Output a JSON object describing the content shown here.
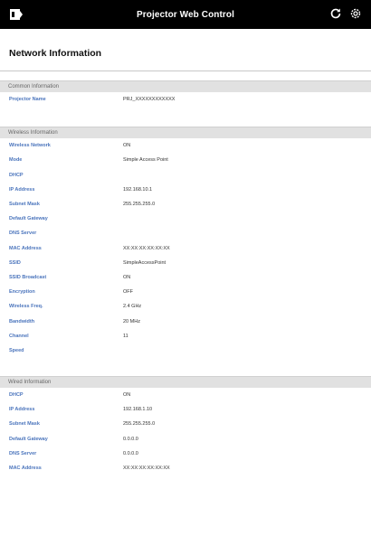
{
  "header": {
    "title": "Projector Web Control"
  },
  "page_title": "Network Information",
  "sections": {
    "common": {
      "title": "Common Information",
      "rows": [
        {
          "label": "Projector Name",
          "value": "PRJ_XXXXXXXXXXXX"
        }
      ]
    },
    "wireless": {
      "title": "Wireless Information",
      "rows": [
        {
          "label": "Wireless Network",
          "value": "ON"
        },
        {
          "label": "Mode",
          "value": "Simple Access Point"
        },
        {
          "label": "DHCP",
          "value": ""
        },
        {
          "label": "IP Address",
          "value": "192.168.10.1"
        },
        {
          "label": "Subnet Mask",
          "value": "255.255.255.0"
        },
        {
          "label": "Default Gateway",
          "value": ""
        },
        {
          "label": "DNS Server",
          "value": ""
        },
        {
          "label": "MAC Address",
          "value": "XX:XX:XX:XX:XX:XX"
        },
        {
          "label": "SSID",
          "value": "SimpleAccessPoint"
        },
        {
          "label": "SSID Broadcast",
          "value": "ON"
        },
        {
          "label": "Encryption",
          "value": "OFF"
        },
        {
          "label": "Wireless Freq.",
          "value": "2.4 GHz"
        },
        {
          "label": "Bandwidth",
          "value": "20 MHz"
        },
        {
          "label": "Channel",
          "value": "11"
        },
        {
          "label": "Speed",
          "value": ""
        }
      ]
    },
    "wired": {
      "title": "Wired Information",
      "rows": [
        {
          "label": "DHCP",
          "value": "ON"
        },
        {
          "label": "IP Address",
          "value": "192.168.1.10"
        },
        {
          "label": "Subnet Mask",
          "value": "255.255.255.0"
        },
        {
          "label": "Default Gateway",
          "value": "0.0.0.0"
        },
        {
          "label": "DNS Server",
          "value": "0.0.0.0"
        },
        {
          "label": "MAC Address",
          "value": "XX:XX:XX:XX:XX:XX"
        }
      ]
    }
  },
  "icons": {
    "menu": "menu-icon",
    "refresh": "refresh-icon",
    "settings": "gear-icon"
  },
  "colors": {
    "header_bg": "#000000",
    "label": "#4a74bc",
    "section_bg": "#e1e1e1"
  }
}
